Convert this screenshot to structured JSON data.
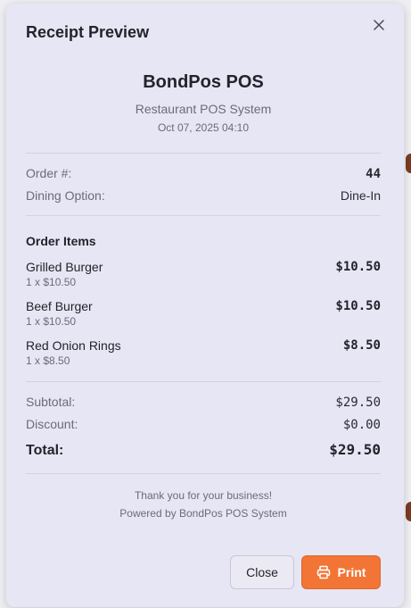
{
  "modal": {
    "title": "Receipt Preview",
    "close_icon": "close-icon"
  },
  "store": {
    "name": "BondPos POS",
    "subtitle": "Restaurant POS System",
    "datetime": "Oct 07, 2025 04:10"
  },
  "order": {
    "number_label": "Order #:",
    "number_value": "44",
    "dining_label": "Dining Option:",
    "dining_value": "Dine-In"
  },
  "items_section": {
    "title": "Order Items",
    "items": [
      {
        "name": "Grilled Burger",
        "detail": "1 x $10.50",
        "price": "$10.50"
      },
      {
        "name": "Beef Burger",
        "detail": "1 x $10.50",
        "price": "$10.50"
      },
      {
        "name": "Red Onion Rings",
        "detail": "1 x $8.50",
        "price": "$8.50"
      }
    ]
  },
  "totals": {
    "subtotal_label": "Subtotal:",
    "subtotal_value": "$29.50",
    "discount_label": "Discount:",
    "discount_value": "$0.00",
    "total_label": "Total:",
    "total_value": "$29.50"
  },
  "footer": {
    "thanks": "Thank you for your business!",
    "powered": "Powered by BondPos POS System"
  },
  "actions": {
    "close_label": "Close",
    "print_label": "Print",
    "print_icon": "printer-icon"
  },
  "colors": {
    "accent": "#f37535",
    "modal_bg": "#e7e6f4"
  }
}
